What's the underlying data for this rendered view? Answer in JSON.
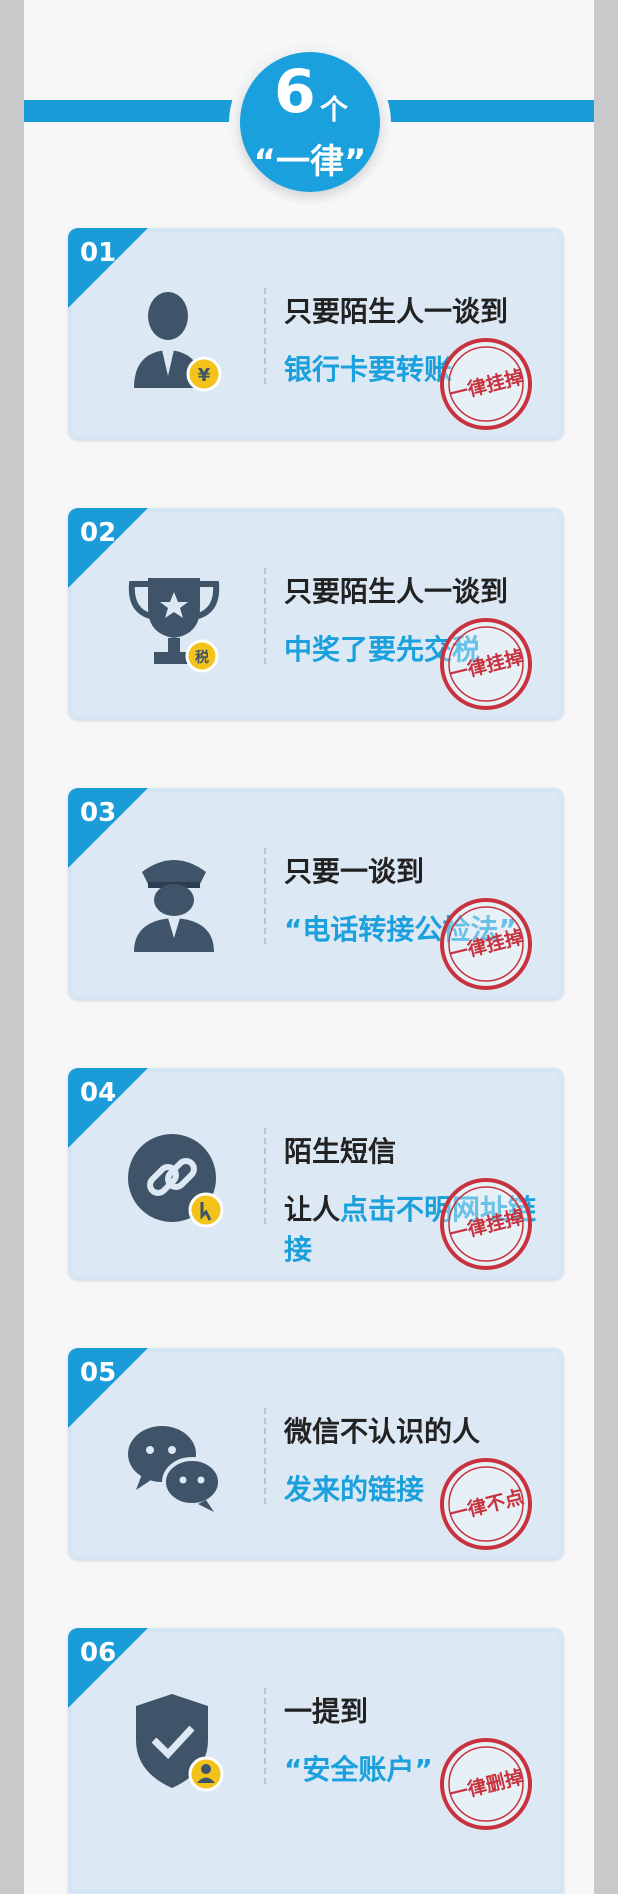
{
  "header": {
    "number": "6",
    "unit": "个",
    "subtitle": "“一律”"
  },
  "cards": [
    {
      "index": "01",
      "line1": "只要陌生人一谈到",
      "line2": "银行卡要转账",
      "stamp": "一律挂掉",
      "icon": "businessman-yen-icon"
    },
    {
      "index": "02",
      "line1": "只要陌生人一谈到",
      "line2": "中奖了要先交税",
      "stamp": "一律挂掉",
      "icon": "trophy-tax-icon"
    },
    {
      "index": "03",
      "line1": "只要一谈到",
      "line2": "“电话转接公检法”",
      "stamp": "一律挂掉",
      "icon": "police-officer-icon"
    },
    {
      "index": "04",
      "line1": "陌生短信",
      "line2_prefix": "让人",
      "line2": "点击不明网址链接",
      "stamp": "一律挂掉",
      "icon": "link-click-icon"
    },
    {
      "index": "05",
      "line1": "微信不认识的人",
      "line2": "发来的链接",
      "stamp": "一律不点",
      "icon": "wechat-icon"
    },
    {
      "index": "06",
      "line1": "一提到",
      "line2": "“安全账户”",
      "stamp": "一律删掉",
      "icon": "shield-user-icon"
    }
  ],
  "colors": {
    "accent": "#1aa0dc",
    "stamp_red": "#c8323c",
    "icon_dark": "#3f5468"
  }
}
